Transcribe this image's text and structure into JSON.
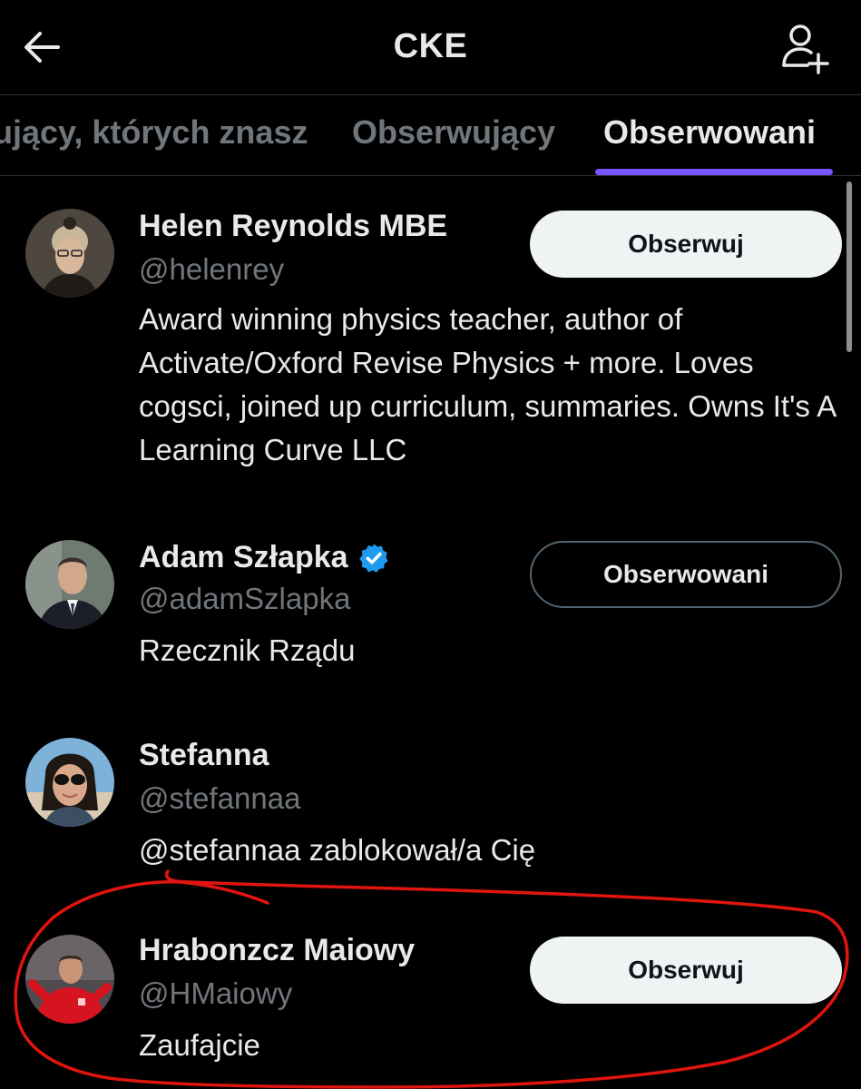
{
  "header": {
    "title": "CKE",
    "back_icon": "arrow-left-icon",
    "add_user_icon": "user-plus-icon"
  },
  "tabs": [
    {
      "label": "ujący, których znasz",
      "active": false
    },
    {
      "label": "Obserwujący",
      "active": false
    },
    {
      "label": "Obserwowani",
      "active": true
    }
  ],
  "colors": {
    "accent": "#7856ff",
    "verified": "#1d9bf0",
    "annotation": "#e0150f"
  },
  "users": [
    {
      "name": "Helen Reynolds MBE",
      "handle": "@helenrey",
      "verified": false,
      "bio": "Award winning physics teacher, author of Activate/Oxford Revise Physics + more. Loves cogsci, joined up curriculum, summaries. Owns It's A Learning Curve LLC",
      "button": "Obserwuj",
      "following": false
    },
    {
      "name": "Adam Szłapka",
      "handle": "@adamSzlapka",
      "verified": true,
      "bio": "Rzecznik Rządu",
      "button": "Obserwowani",
      "following": true
    },
    {
      "name": "Stefanna",
      "handle": "@stefannaa",
      "verified": false,
      "bio": "@stefannaa zablokował/a Cię",
      "button": null,
      "following": false
    },
    {
      "name": "Hrabonzcz Maiowy",
      "handle": "@HMaiowy",
      "verified": false,
      "bio": "Zaufajcie",
      "button": "Obserwuj",
      "following": false
    }
  ]
}
